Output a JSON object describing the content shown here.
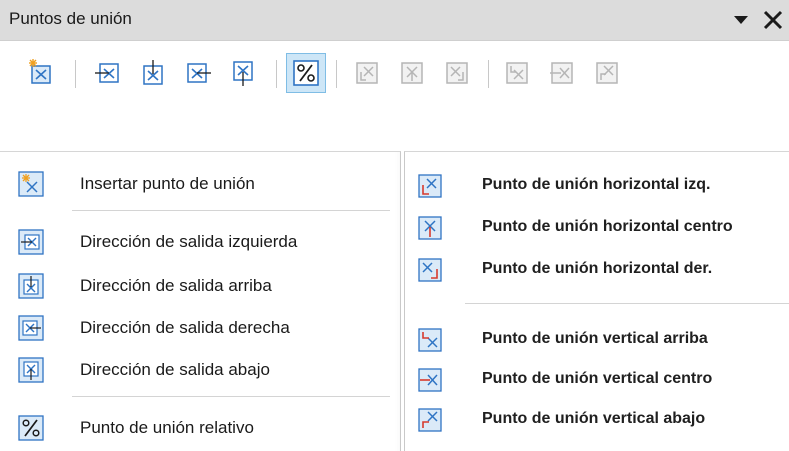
{
  "toolbar": {
    "title": "Puntos de unión",
    "menu_icon": "dropdown-triangle-icon",
    "close_icon": "close-x-icon",
    "buttons": [
      {
        "name": "insert-glue-point",
        "icon": "insert-glue-point-icon"
      },
      {
        "name": "exit-direction-left",
        "icon": "exit-left-icon"
      },
      {
        "name": "exit-direction-top",
        "icon": "exit-top-icon"
      },
      {
        "name": "exit-direction-right",
        "icon": "exit-right-icon"
      },
      {
        "name": "exit-direction-bottom",
        "icon": "exit-bottom-icon"
      },
      {
        "name": "glue-point-relative",
        "icon": "percent-icon",
        "checked": true
      },
      {
        "name": "glue-horizontal-left",
        "icon": "glue-h-left-icon",
        "disabled": true
      },
      {
        "name": "glue-horizontal-center",
        "icon": "glue-h-center-icon",
        "disabled": true
      },
      {
        "name": "glue-horizontal-right",
        "icon": "glue-h-right-icon",
        "disabled": true
      },
      {
        "name": "glue-vertical-top",
        "icon": "glue-v-top-icon",
        "disabled": true
      },
      {
        "name": "glue-vertical-center",
        "icon": "glue-v-center-icon",
        "disabled": true
      },
      {
        "name": "glue-vertical-bottom",
        "icon": "glue-v-bottom-icon",
        "disabled": true
      }
    ]
  },
  "menu_left": {
    "items": [
      {
        "label": "Insertar punto de unión",
        "icon": "insert-glue-point-icon"
      },
      {
        "label": "Dirección de salida izquierda",
        "icon": "exit-left-icon"
      },
      {
        "label": "Dirección de salida arriba",
        "icon": "exit-top-icon"
      },
      {
        "label": "Dirección de salida derecha",
        "icon": "exit-right-icon"
      },
      {
        "label": "Dirección de salida abajo",
        "icon": "exit-bottom-icon"
      },
      {
        "label": "Punto de unión relativo",
        "icon": "percent-icon"
      }
    ]
  },
  "menu_right": {
    "items": [
      {
        "label": "Punto de unión horizontal izq.",
        "icon": "glue-h-left-icon"
      },
      {
        "label": "Punto de unión horizontal centro",
        "icon": "glue-h-center-icon"
      },
      {
        "label": "Punto de unión horizontal der.",
        "icon": "glue-h-right-icon"
      },
      {
        "label": "Punto de unión vertical arriba",
        "icon": "glue-v-top-icon"
      },
      {
        "label": "Punto de unión vertical centro",
        "icon": "glue-v-center-icon"
      },
      {
        "label": "Punto de unión vertical abajo",
        "icon": "glue-v-bottom-icon"
      }
    ]
  },
  "colors": {
    "icon_blue": "#2f74c4",
    "icon_fill": "#dbeaf8",
    "accent_red": "#d83a2e",
    "disabled_gray": "#b5b5b5",
    "checked_bg": "#cde6f7"
  }
}
